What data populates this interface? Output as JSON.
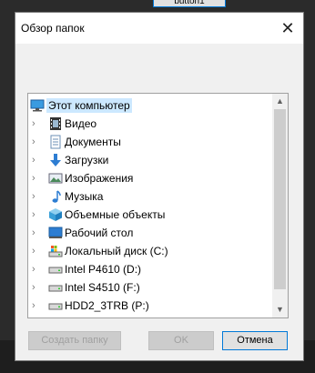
{
  "background": {
    "button_label": "button1"
  },
  "dialog": {
    "title": "Обзор папок",
    "close_glyph": "✕",
    "buttons": {
      "new_folder": "Создать папку",
      "ok": "OK",
      "cancel": "Отмена"
    }
  },
  "tree": {
    "root_label": "Этот компьютер",
    "items": [
      {
        "label": "Видео",
        "icon": "video-icon"
      },
      {
        "label": "Документы",
        "icon": "documents-icon"
      },
      {
        "label": "Загрузки",
        "icon": "downloads-icon"
      },
      {
        "label": "Изображения",
        "icon": "pictures-icon"
      },
      {
        "label": "Музыка",
        "icon": "music-icon"
      },
      {
        "label": "Объемные объекты",
        "icon": "3d-objects-icon"
      },
      {
        "label": "Рабочий стол",
        "icon": "desktop-icon"
      },
      {
        "label": "Локальный диск (C:)",
        "icon": "system-drive-icon"
      },
      {
        "label": "Intel P4610 (D:)",
        "icon": "drive-icon"
      },
      {
        "label": "Intel S4510 (F:)",
        "icon": "drive-icon"
      },
      {
        "label": "HDD2_3TRB (P:)",
        "icon": "drive-icon"
      }
    ]
  },
  "colors": {
    "selection": "#cce8ff",
    "accent": "#0078d7",
    "window_bg": "#f0f0f0"
  }
}
